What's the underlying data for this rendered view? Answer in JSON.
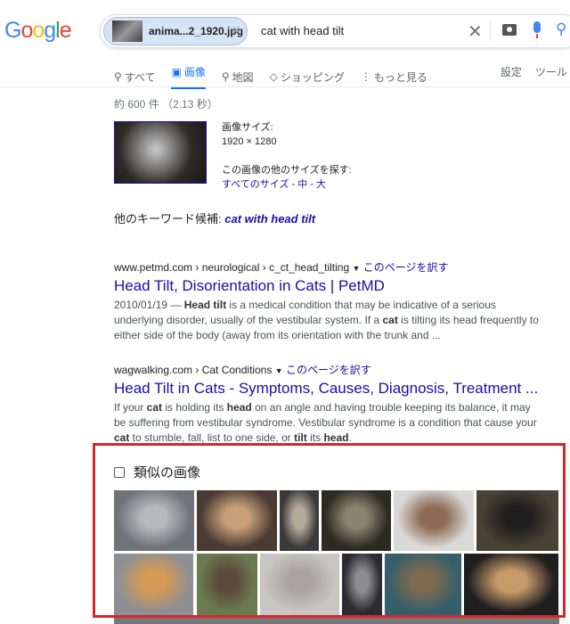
{
  "logo": {
    "text": "Google",
    "colors": [
      "#4285f4",
      "#ea4335",
      "#fbbc05",
      "#4285f4",
      "#34a853",
      "#ea4335"
    ]
  },
  "search": {
    "image_chip": "anima...2_1920.jpg",
    "query": "cat with head tilt",
    "icons": [
      "close-icon",
      "camera-icon",
      "mic-icon",
      "search-icon"
    ]
  },
  "tabs": [
    {
      "label": "すべて",
      "icon": "search-icon"
    },
    {
      "label": "画像",
      "icon": "image-icon",
      "active": true
    },
    {
      "label": "地図",
      "icon": "pin-icon"
    },
    {
      "label": "ショッピング",
      "icon": "tag-icon"
    },
    {
      "label": "もっと見る",
      "icon": "more-icon"
    }
  ],
  "tools": {
    "settings": "設定",
    "tools": "ツール"
  },
  "stats": "約 600 件 （2.13 秒）",
  "image_info": {
    "size_label": "画像サイズ:",
    "size": "1920 × 1280",
    "other_sizes_label": "この画像の他のサイズを探す:",
    "all_sizes": "すべてのサイズ",
    "sep": " - ",
    "medium": "中",
    "large": "大"
  },
  "keyword": {
    "label": "他のキーワード候補:",
    "value": "cat with head tilt"
  },
  "results": [
    {
      "cite": "www.petmd.com › neurological › c_ct_head_tilting",
      "translate": "このページを訳す",
      "title": "Head Tilt, Disorientation in Cats | PetMD",
      "snippet_html": "2010/01/19 — <b>Head tilt</b> is a medical condition that may be indicative of a serious underlying disorder, usually of the vestibular system. If a <b>cat</b> is tilting its head frequently to either side of the body (away from its orientation with the trunk and ..."
    },
    {
      "cite": "wagwalking.com › Cat Conditions",
      "translate": "このページを訳す",
      "title": "Head Tilt in Cats - Symptoms, Causes, Diagnosis, Treatment ...",
      "snippet_html": "If your <b>cat</b> is holding its <b>head</b> on an angle and having trouble keeping its balance, it may be suffering from vestibular syndrome. Vestibular syndrome is a condition that cause your <b>cat</b> to stumble, fall, list to one side, or <b>tilt</b> its <b>head</b>."
    }
  ],
  "similar": {
    "title": "類似の画像",
    "highlight_color": "#d8252c"
  }
}
